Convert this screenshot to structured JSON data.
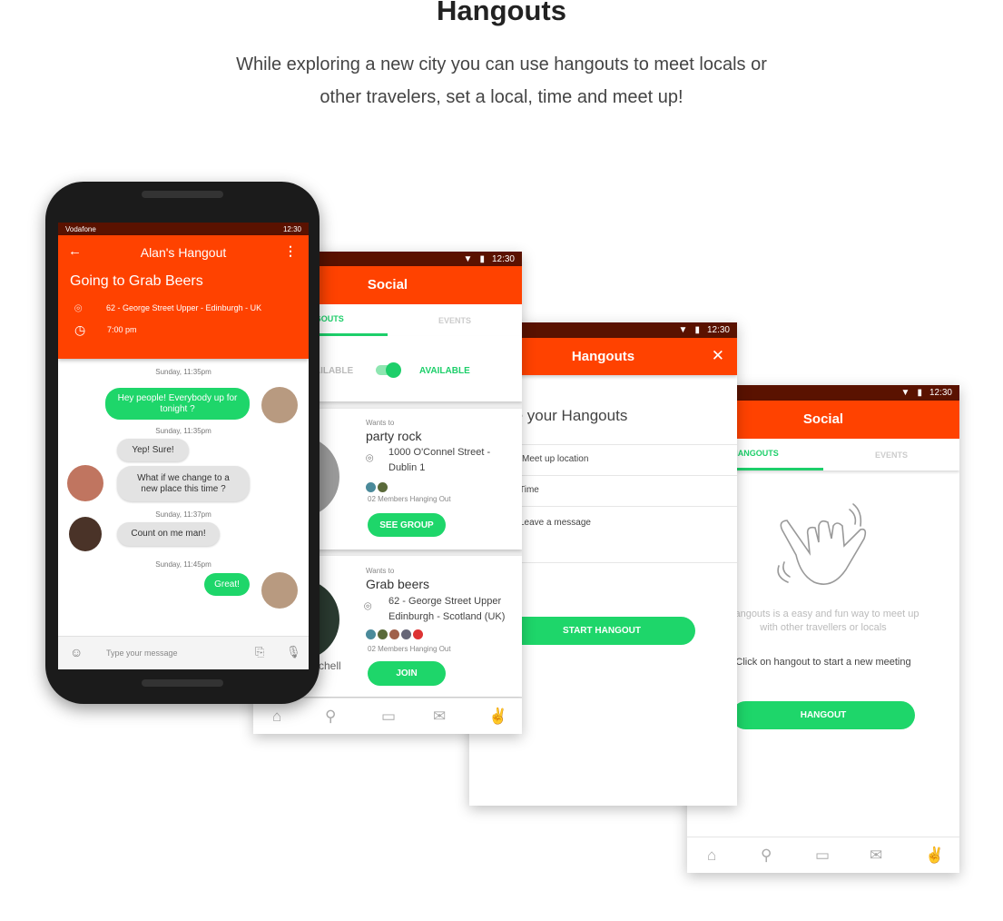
{
  "page": {
    "title": "Hangouts",
    "subtitle_line1": "While exploring a new city you can use hangouts to meet locals or",
    "subtitle_line2": "other travelers, set  a local, time and meet up!"
  },
  "colors": {
    "accent": "#ff4200",
    "green": "#1ed66a",
    "status_bar": "#5a1200"
  },
  "status": {
    "carrier": "Vodafone",
    "time": "12:30"
  },
  "chat": {
    "title": "Alan's Hangout",
    "heading": "Going to Grab Beers",
    "address": "62 - George Street Upper  - Edinburgh - UK",
    "time": "7:00 pm",
    "messages": [
      {
        "ts": "Sunday, 11:35pm",
        "text": "Hey people! Everybody up for tonight ?",
        "from": "me"
      },
      {
        "ts": "Sunday, 11:35pm",
        "text": "Yep! Sure!",
        "from": "them"
      },
      {
        "text": "What if we change to a new place this time ?",
        "from": "them"
      },
      {
        "ts": "Sunday, 11:37pm",
        "text": "Count on me man!",
        "from": "them"
      },
      {
        "ts": "Sunday, 11:45pm",
        "text": "Great!",
        "from": "me"
      }
    ],
    "input_placeholder": "Type your message"
  },
  "social": {
    "title": "Social",
    "tabs": [
      "HANGOUTS",
      "EVENTS"
    ],
    "unavailable": "UNAVAILABLE",
    "available": "AVAILABLE",
    "available_on": true,
    "cards": [
      {
        "wants": "Wants to",
        "activity": "party rock",
        "address1": "1000 O'Connel Street -",
        "address2": "Dublin 1",
        "members": "02 Members Hanging Out",
        "button": "SEE GROUP"
      },
      {
        "wants": "Wants to",
        "activity": "Grab beers",
        "address1": "62 - George Street Upper",
        "address2": "Edinburgh - Scotland (UK)",
        "members": "02 Members Hanging Out",
        "button": "JOIN",
        "name": "Mitchell"
      }
    ]
  },
  "create": {
    "title": "Hangouts",
    "heading": "Create your Hangouts",
    "fields": [
      "Meet up location",
      "Time",
      "Leave a message"
    ],
    "button": "START HANGOUT"
  },
  "empty": {
    "title": "Social",
    "tabs": [
      "HANGOUTS",
      "EVENTS"
    ],
    "desc1": "Hangouts is a easy and fun way to meet up",
    "desc2": "with other travellers or locals",
    "hint": "Click on hangout to start a new meeting",
    "button": "HANGOUT"
  },
  "nav": [
    "home-icon",
    "search-icon",
    "sofa-icon",
    "mail-icon",
    "hangout-hand-icon"
  ]
}
